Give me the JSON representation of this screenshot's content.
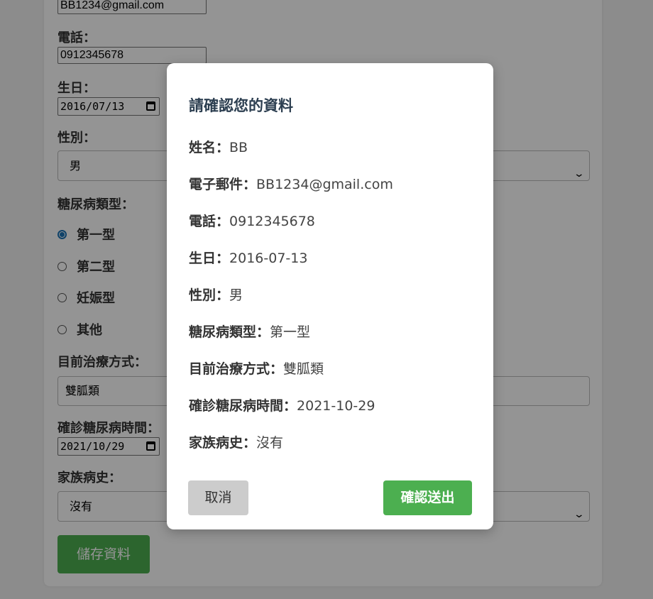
{
  "form": {
    "email_value": "BB1234@gmail.com",
    "phone_label": "電話：",
    "phone_value": "0912345678",
    "birthday_label": "生日：",
    "birthday_value": "2016/07/13",
    "gender_label": "性別：",
    "gender_value": "男",
    "diabetes_type_label": "糖尿病類型：",
    "diabetes_type_options": [
      "第一型",
      "第二型",
      "妊娠型",
      "其他"
    ],
    "diabetes_type_selected": "第一型",
    "treatment_label": "目前治療方式：",
    "treatment_value": "雙胍類",
    "diagnosis_date_label": "確診糖尿病時間：",
    "diagnosis_date_value": "2021/10/29",
    "family_history_label": "家族病史：",
    "family_history_value": "沒有",
    "save_button": "儲存資料"
  },
  "modal": {
    "title": "請確認您的資料",
    "rows": [
      {
        "key": "姓名：",
        "value": "BB"
      },
      {
        "key": "電子郵件：",
        "value": "BB1234@gmail.com"
      },
      {
        "key": "電話：",
        "value": "0912345678"
      },
      {
        "key": "生日：",
        "value": "2016-07-13"
      },
      {
        "key": "性別：",
        "value": "男"
      },
      {
        "key": "糖尿病類型：",
        "value": "第一型"
      },
      {
        "key": "目前治療方式：",
        "value": "雙胍類"
      },
      {
        "key": "確診糖尿病時間：",
        "value": "2021-10-29"
      },
      {
        "key": "家族病史：",
        "value": "沒有"
      }
    ],
    "cancel_button": "取消",
    "confirm_button": "確認送出"
  },
  "colors": {
    "primary_green": "#4caf50",
    "cancel_gray": "#cccccc",
    "title_color": "#2c3e50"
  }
}
